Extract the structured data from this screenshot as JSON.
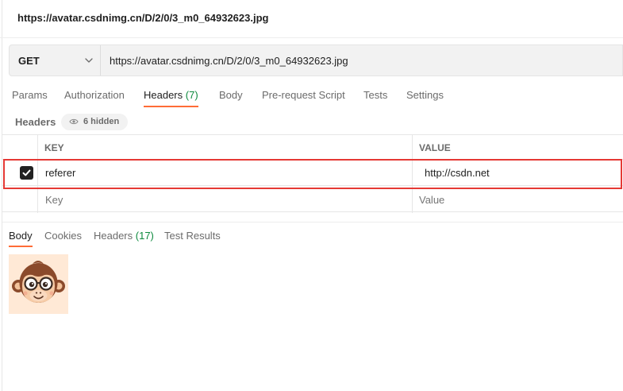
{
  "request": {
    "title": "https://avatar.csdnimg.cn/D/2/0/3_m0_64932623.jpg",
    "method": "GET",
    "url": "https://avatar.csdnimg.cn/D/2/0/3_m0_64932623.jpg"
  },
  "request_tabs": [
    {
      "label": "Params",
      "count": ""
    },
    {
      "label": "Authorization",
      "count": ""
    },
    {
      "label": "Headers",
      "count": "(7)"
    },
    {
      "label": "Body",
      "count": ""
    },
    {
      "label": "Pre-request Script",
      "count": ""
    },
    {
      "label": "Tests",
      "count": ""
    },
    {
      "label": "Settings",
      "count": ""
    }
  ],
  "active_request_tab": "Headers",
  "headers_section": {
    "label": "Headers",
    "hidden_text": "6 hidden"
  },
  "headers_table": {
    "columns": {
      "key": "KEY",
      "value": "VALUE"
    },
    "rows": [
      {
        "checked": true,
        "key": "referer",
        "value": "http://csdn.net"
      }
    ],
    "new_row": {
      "key_placeholder": "Key",
      "value_placeholder": "Value"
    }
  },
  "response_tabs": [
    {
      "label": "Body",
      "count": ""
    },
    {
      "label": "Cookies",
      "count": ""
    },
    {
      "label": "Headers",
      "count": "(17)"
    },
    {
      "label": "Test Results",
      "count": ""
    }
  ],
  "active_response_tab": "Body",
  "colors": {
    "accent": "#ff6c37",
    "count_green": "#0e8a3e",
    "highlight": "#e53935"
  },
  "icons": {
    "method_dropdown": "chevron-down-icon",
    "hidden_headers": "eye-icon",
    "row_checkbox": "checkmark-icon",
    "preview": "monkey-avatar-image"
  }
}
